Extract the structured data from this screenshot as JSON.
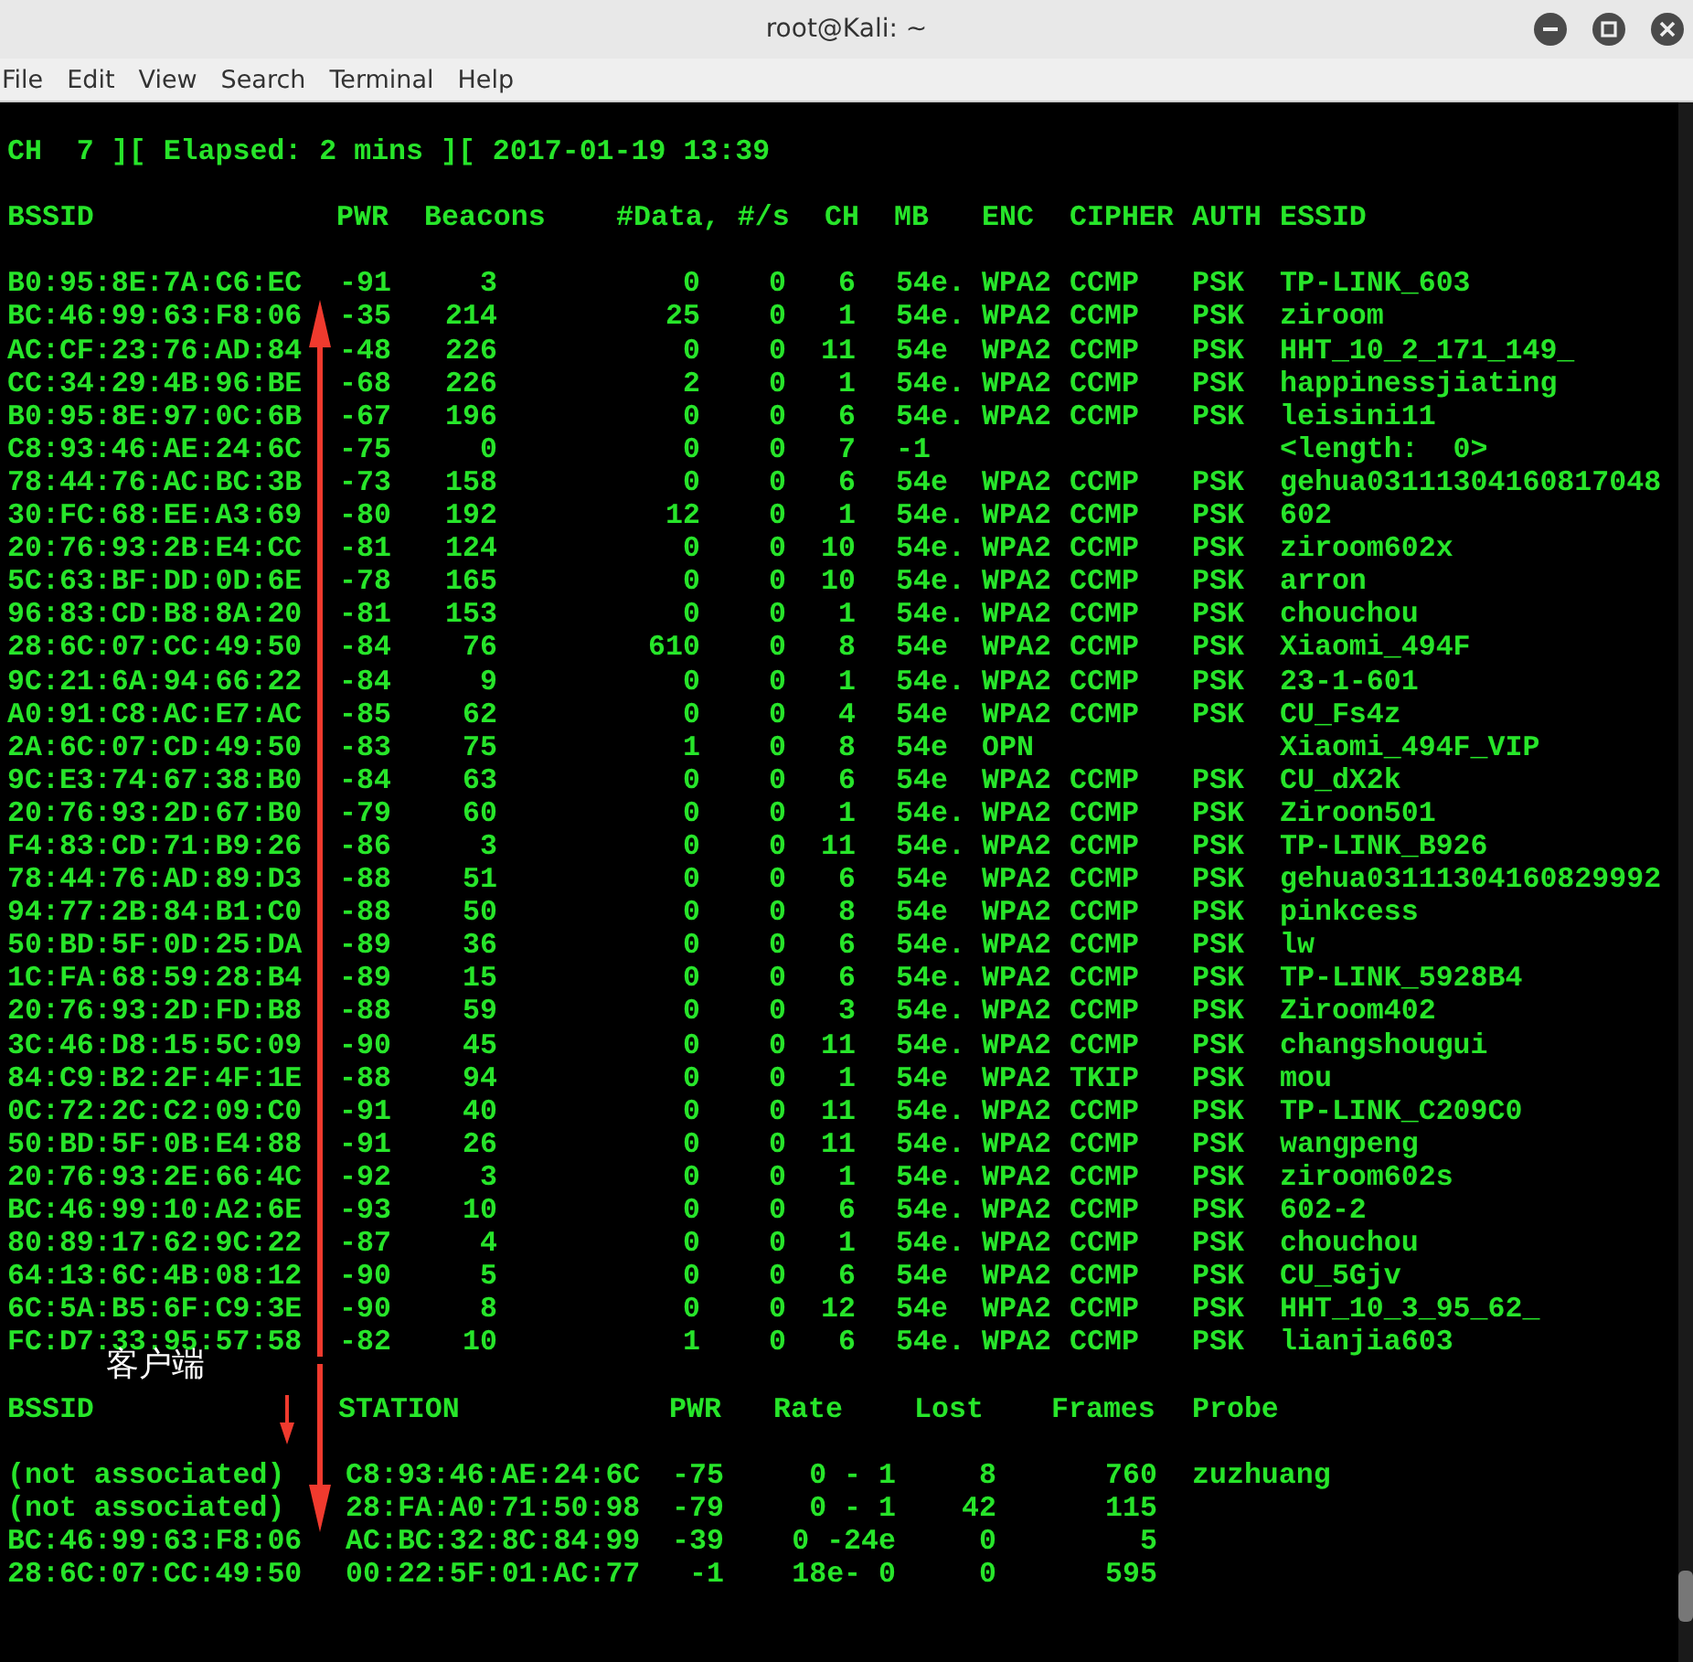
{
  "window": {
    "title": "root@Kali: ~"
  },
  "menu": [
    "File",
    "Edit",
    "View",
    "Search",
    "Terminal",
    "Help"
  ],
  "status_line": "CH  7 ][ Elapsed: 2 mins ][ 2017-01-19 13:39",
  "ap_table": {
    "columns": [
      "BSSID",
      "PWR",
      "Beacons",
      "#Data, #/s",
      "CH",
      "MB",
      "ENC",
      "CIPHER",
      "AUTH",
      "ESSID"
    ],
    "rows": [
      {
        "bssid": "B0:95:8E:7A:C6:EC",
        "pwr": "-91",
        "beacons": "3",
        "data": "0",
        "per_s": "0",
        "ch": "6",
        "mb": "54e.",
        "enc": "WPA2",
        "cipher": "CCMP",
        "auth": "PSK",
        "essid": "TP-LINK_603"
      },
      {
        "bssid": "BC:46:99:63:F8:06",
        "pwr": "-35",
        "beacons": "214",
        "data": "25",
        "per_s": "0",
        "ch": "1",
        "mb": "54e.",
        "enc": "WPA2",
        "cipher": "CCMP",
        "auth": "PSK",
        "essid": "ziroom"
      },
      {
        "bssid": "AC:CF:23:76:AD:84",
        "pwr": "-48",
        "beacons": "226",
        "data": "0",
        "per_s": "0",
        "ch": "11",
        "mb": "54e",
        "enc": "WPA2",
        "cipher": "CCMP",
        "auth": "PSK",
        "essid": "HHT_10_2_171_149_"
      },
      {
        "bssid": "CC:34:29:4B:96:BE",
        "pwr": "-68",
        "beacons": "226",
        "data": "2",
        "per_s": "0",
        "ch": "1",
        "mb": "54e.",
        "enc": "WPA2",
        "cipher": "CCMP",
        "auth": "PSK",
        "essid": "happinessjiating"
      },
      {
        "bssid": "B0:95:8E:97:0C:6B",
        "pwr": "-67",
        "beacons": "196",
        "data": "0",
        "per_s": "0",
        "ch": "6",
        "mb": "54e.",
        "enc": "WPA2",
        "cipher": "CCMP",
        "auth": "PSK",
        "essid": "leisini11"
      },
      {
        "bssid": "C8:93:46:AE:24:6C",
        "pwr": "-75",
        "beacons": "0",
        "data": "0",
        "per_s": "0",
        "ch": "7",
        "mb": "-1",
        "essid": "<length:  0>"
      },
      {
        "bssid": "78:44:76:AC:BC:3B",
        "pwr": "-73",
        "beacons": "158",
        "data": "0",
        "per_s": "0",
        "ch": "6",
        "mb": "54e",
        "enc": "WPA2",
        "cipher": "CCMP",
        "auth": "PSK",
        "essid": "gehua03111304160817048"
      },
      {
        "bssid": "30:FC:68:EE:A3:69",
        "pwr": "-80",
        "beacons": "192",
        "data": "12",
        "per_s": "0",
        "ch": "1",
        "mb": "54e.",
        "enc": "WPA2",
        "cipher": "CCMP",
        "auth": "PSK",
        "essid": "602"
      },
      {
        "bssid": "20:76:93:2B:E4:CC",
        "pwr": "-81",
        "beacons": "124",
        "data": "0",
        "per_s": "0",
        "ch": "10",
        "mb": "54e.",
        "enc": "WPA2",
        "cipher": "CCMP",
        "auth": "PSK",
        "essid": "ziroom602x"
      },
      {
        "bssid": "5C:63:BF:DD:0D:6E",
        "pwr": "-78",
        "beacons": "165",
        "data": "0",
        "per_s": "0",
        "ch": "10",
        "mb": "54e.",
        "enc": "WPA2",
        "cipher": "CCMP",
        "auth": "PSK",
        "essid": "arron"
      },
      {
        "bssid": "96:83:CD:B8:8A:20",
        "pwr": "-81",
        "beacons": "153",
        "data": "0",
        "per_s": "0",
        "ch": "1",
        "mb": "54e.",
        "enc": "WPA2",
        "cipher": "CCMP",
        "auth": "PSK",
        "essid": "chouchou"
      },
      {
        "bssid": "28:6C:07:CC:49:50",
        "pwr": "-84",
        "beacons": "76",
        "data": "610",
        "per_s": "0",
        "ch": "8",
        "mb": "54e",
        "enc": "WPA2",
        "cipher": "CCMP",
        "auth": "PSK",
        "essid": "Xiaomi_494F"
      },
      {
        "bssid": "9C:21:6A:94:66:22",
        "pwr": "-84",
        "beacons": "9",
        "data": "0",
        "per_s": "0",
        "ch": "1",
        "mb": "54e.",
        "enc": "WPA2",
        "cipher": "CCMP",
        "auth": "PSK",
        "essid": "23-1-601"
      },
      {
        "bssid": "A0:91:C8:AC:E7:AC",
        "pwr": "-85",
        "beacons": "62",
        "data": "0",
        "per_s": "0",
        "ch": "4",
        "mb": "54e",
        "enc": "WPA2",
        "cipher": "CCMP",
        "auth": "PSK",
        "essid": "CU_Fs4z"
      },
      {
        "bssid": "2A:6C:07:CD:49:50",
        "pwr": "-83",
        "beacons": "75",
        "data": "1",
        "per_s": "0",
        "ch": "8",
        "mb": "54e",
        "enc": "OPN",
        "essid": "Xiaomi_494F_VIP"
      },
      {
        "bssid": "9C:E3:74:67:38:B0",
        "pwr": "-84",
        "beacons": "63",
        "data": "0",
        "per_s": "0",
        "ch": "6",
        "mb": "54e",
        "enc": "WPA2",
        "cipher": "CCMP",
        "auth": "PSK",
        "essid": "CU_dX2k"
      },
      {
        "bssid": "20:76:93:2D:67:B0",
        "pwr": "-79",
        "beacons": "60",
        "data": "0",
        "per_s": "0",
        "ch": "1",
        "mb": "54e.",
        "enc": "WPA2",
        "cipher": "CCMP",
        "auth": "PSK",
        "essid": "Ziroon501"
      },
      {
        "bssid": "F4:83:CD:71:B9:26",
        "pwr": "-86",
        "beacons": "3",
        "data": "0",
        "per_s": "0",
        "ch": "11",
        "mb": "54e.",
        "enc": "WPA2",
        "cipher": "CCMP",
        "auth": "PSK",
        "essid": "TP-LINK_B926"
      },
      {
        "bssid": "78:44:76:AD:89:D3",
        "pwr": "-88",
        "beacons": "51",
        "data": "0",
        "per_s": "0",
        "ch": "6",
        "mb": "54e",
        "enc": "WPA2",
        "cipher": "CCMP",
        "auth": "PSK",
        "essid": "gehua03111304160829992"
      },
      {
        "bssid": "94:77:2B:84:B1:C0",
        "pwr": "-88",
        "beacons": "50",
        "data": "0",
        "per_s": "0",
        "ch": "8",
        "mb": "54e",
        "enc": "WPA2",
        "cipher": "CCMP",
        "auth": "PSK",
        "essid": "pinkcess"
      },
      {
        "bssid": "50:BD:5F:0D:25:DA",
        "pwr": "-89",
        "beacons": "36",
        "data": "0",
        "per_s": "0",
        "ch": "6",
        "mb": "54e.",
        "enc": "WPA2",
        "cipher": "CCMP",
        "auth": "PSK",
        "essid": "lw"
      },
      {
        "bssid": "1C:FA:68:59:28:B4",
        "pwr": "-89",
        "beacons": "15",
        "data": "0",
        "per_s": "0",
        "ch": "6",
        "mb": "54e.",
        "enc": "WPA2",
        "cipher": "CCMP",
        "auth": "PSK",
        "essid": "TP-LINK_5928B4"
      },
      {
        "bssid": "20:76:93:2D:FD:B8",
        "pwr": "-88",
        "beacons": "59",
        "data": "0",
        "per_s": "0",
        "ch": "3",
        "mb": "54e.",
        "enc": "WPA2",
        "cipher": "CCMP",
        "auth": "PSK",
        "essid": "Ziroom402"
      },
      {
        "bssid": "3C:46:D8:15:5C:09",
        "pwr": "-90",
        "beacons": "45",
        "data": "0",
        "per_s": "0",
        "ch": "11",
        "mb": "54e.",
        "enc": "WPA2",
        "cipher": "CCMP",
        "auth": "PSK",
        "essid": "changshougui"
      },
      {
        "bssid": "84:C9:B2:2F:4F:1E",
        "pwr": "-88",
        "beacons": "94",
        "data": "0",
        "per_s": "0",
        "ch": "1",
        "mb": "54e",
        "enc": "WPA2",
        "cipher": "TKIP",
        "auth": "PSK",
        "essid": "mou"
      },
      {
        "bssid": "0C:72:2C:C2:09:C0",
        "pwr": "-91",
        "beacons": "40",
        "data": "0",
        "per_s": "0",
        "ch": "11",
        "mb": "54e.",
        "enc": "WPA2",
        "cipher": "CCMP",
        "auth": "PSK",
        "essid": "TP-LINK_C209C0"
      },
      {
        "bssid": "50:BD:5F:0B:E4:88",
        "pwr": "-91",
        "beacons": "26",
        "data": "0",
        "per_s": "0",
        "ch": "11",
        "mb": "54e.",
        "enc": "WPA2",
        "cipher": "CCMP",
        "auth": "PSK",
        "essid": "wangpeng"
      },
      {
        "bssid": "20:76:93:2E:66:4C",
        "pwr": "-92",
        "beacons": "3",
        "data": "0",
        "per_s": "0",
        "ch": "1",
        "mb": "54e.",
        "enc": "WPA2",
        "cipher": "CCMP",
        "auth": "PSK",
        "essid": "ziroom602s"
      },
      {
        "bssid": "BC:46:99:10:A2:6E",
        "pwr": "-93",
        "beacons": "10",
        "data": "0",
        "per_s": "0",
        "ch": "6",
        "mb": "54e.",
        "enc": "WPA2",
        "cipher": "CCMP",
        "auth": "PSK",
        "essid": "602-2"
      },
      {
        "bssid": "80:89:17:62:9C:22",
        "pwr": "-87",
        "beacons": "4",
        "data": "0",
        "per_s": "0",
        "ch": "1",
        "mb": "54e.",
        "enc": "WPA2",
        "cipher": "CCMP",
        "auth": "PSK",
        "essid": "chouchou"
      },
      {
        "bssid": "64:13:6C:4B:08:12",
        "pwr": "-90",
        "beacons": "5",
        "data": "0",
        "per_s": "0",
        "ch": "6",
        "mb": "54e",
        "enc": "WPA2",
        "cipher": "CCMP",
        "auth": "PSK",
        "essid": "CU_5Gjv"
      },
      {
        "bssid": "6C:5A:B5:6F:C9:3E",
        "pwr": "-90",
        "beacons": "8",
        "data": "0",
        "per_s": "0",
        "ch": "12",
        "mb": "54e",
        "enc": "WPA2",
        "cipher": "CCMP",
        "auth": "PSK",
        "essid": "HHT_10_3_95_62_"
      },
      {
        "bssid": "FC:D7:33:95:57:58",
        "pwr": "-82",
        "beacons": "10",
        "data": "1",
        "per_s": "0",
        "ch": "6",
        "mb": "54e.",
        "enc": "WPA2",
        "cipher": "CCMP",
        "auth": "PSK",
        "essid": "lianjia603"
      }
    ]
  },
  "client_table": {
    "columns": [
      "BSSID",
      "STATION",
      "PWR",
      "Rate",
      "Lost",
      "Frames",
      "Probe"
    ],
    "rows": [
      {
        "bssid": "(not associated)",
        "station": "C8:93:46:AE:24:6C",
        "pwr": "-75",
        "rate": "0 - 1",
        "lost": "8",
        "frames": "760",
        "probe": "zuzhuang"
      },
      {
        "bssid": "(not associated)",
        "station": "28:FA:A0:71:50:98",
        "pwr": "-79",
        "rate": "0 - 1",
        "lost": "42",
        "frames": "115"
      },
      {
        "bssid": "BC:46:99:63:F8:06",
        "station": "AC:BC:32:8C:84:99",
        "pwr": "-39",
        "rate": "0 -24e",
        "lost": "0",
        "frames": "5"
      },
      {
        "bssid": "28:6C:07:CC:49:50",
        "station": "00:22:5F:01:AC:77",
        "pwr": "-1",
        "rate": "18e- 0",
        "lost": "0",
        "frames": "595"
      }
    ]
  },
  "annotation": {
    "label": "客户端"
  }
}
